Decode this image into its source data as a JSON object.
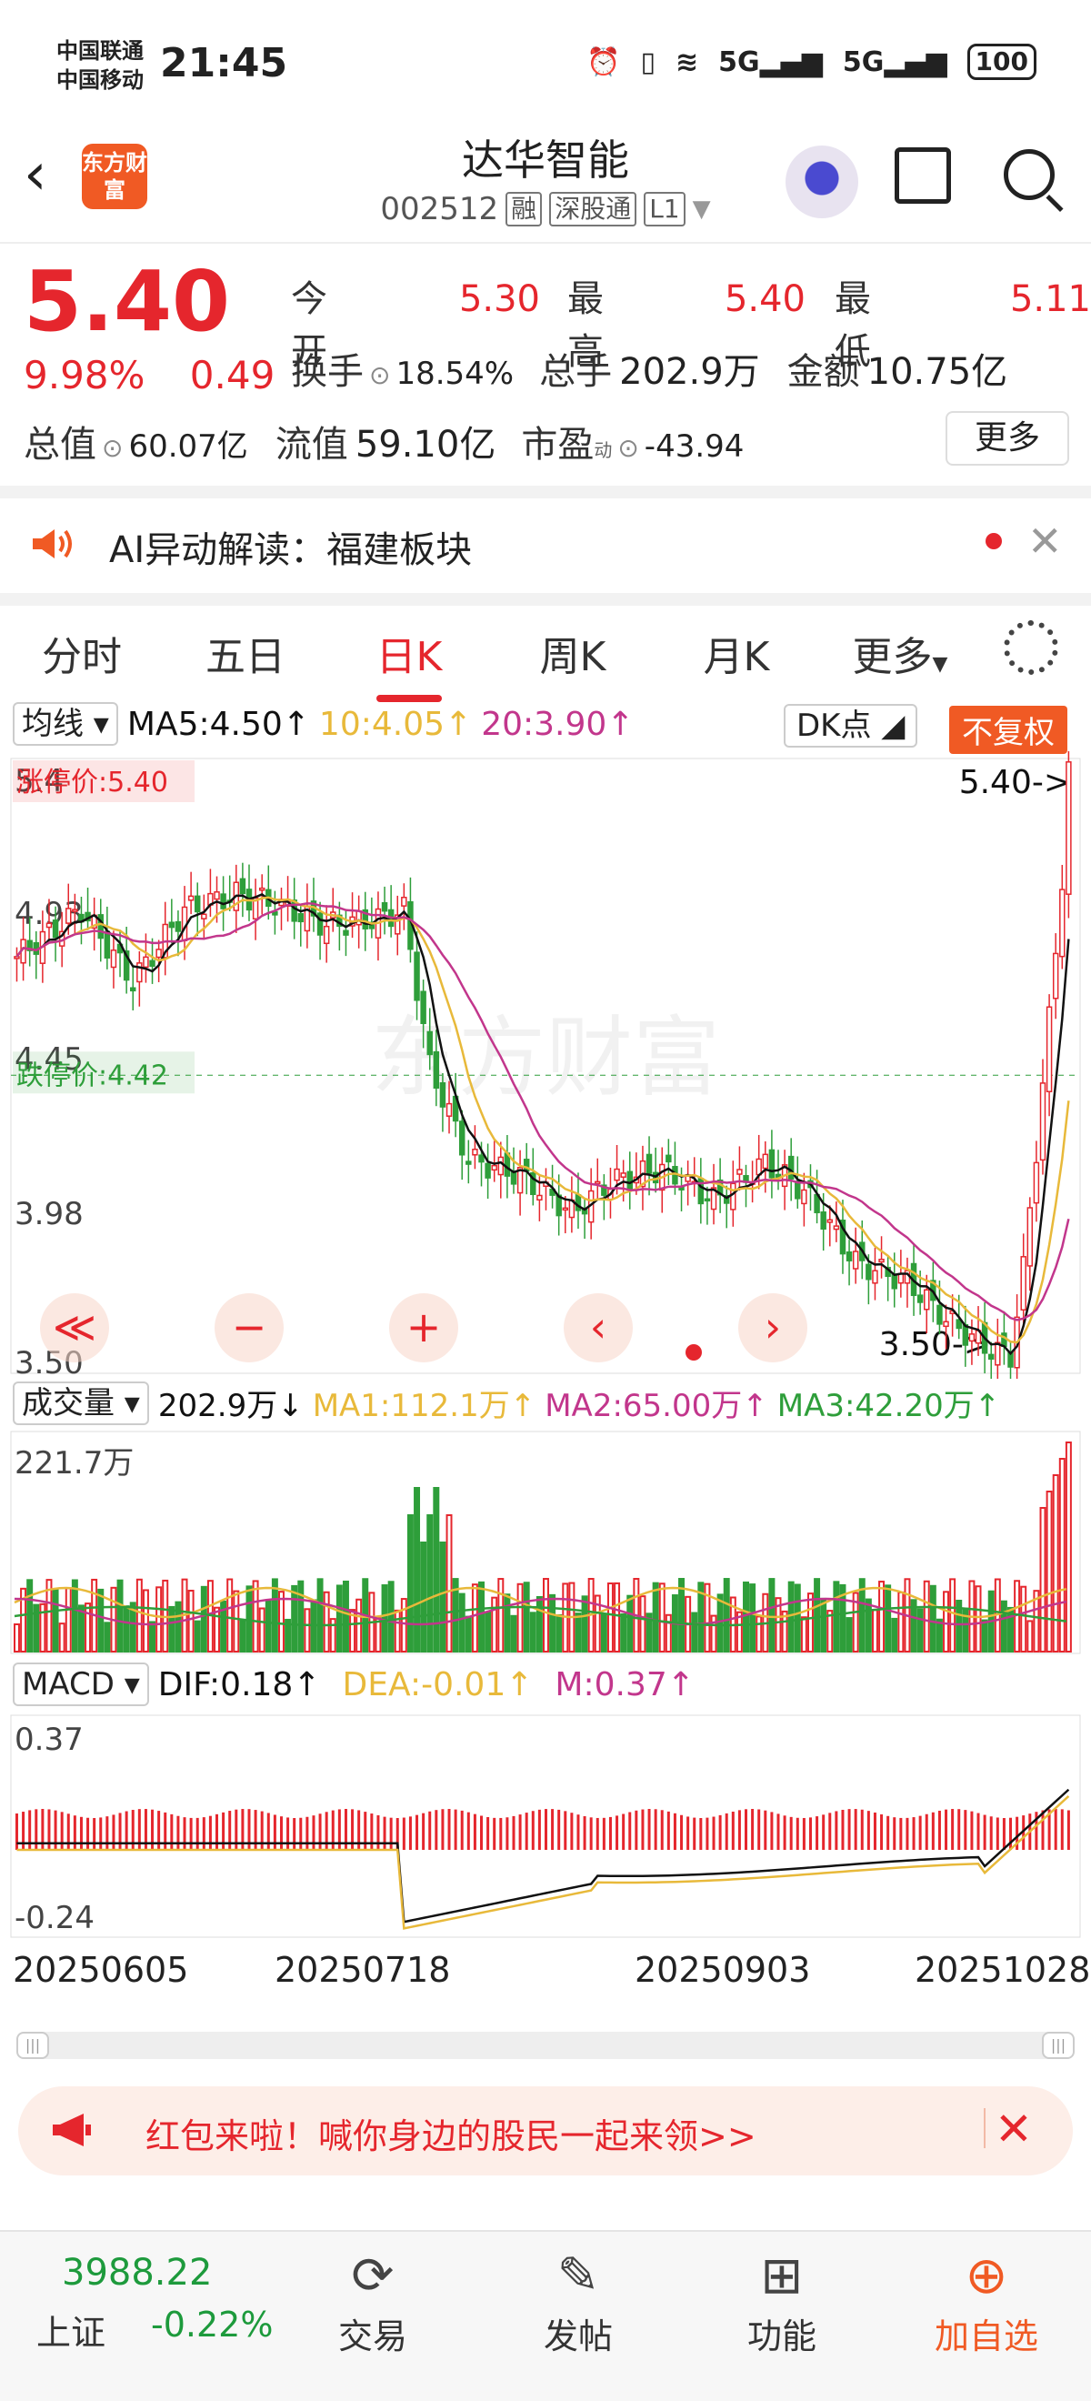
{
  "status_bar": {
    "carrier1": "中国联通",
    "carrier2": "中国移动",
    "time": "21:45",
    "net1": "5G",
    "net2": "5G",
    "battery": "100"
  },
  "header": {
    "logo_text": "东方财富",
    "stock_name": "达华智能",
    "stock_code": "002512",
    "tags": [
      "融",
      "深股通",
      "L1"
    ]
  },
  "quote": {
    "price": "5.40",
    "change_pct": "9.98%",
    "change": "0.49",
    "open_label": "今开",
    "open": "5.30",
    "high_label": "最高",
    "high": "5.40",
    "low_label": "最低",
    "low": "5.11",
    "turnover_label": "换手",
    "turnover": "18.54%",
    "volume_label": "总手",
    "volume": "202.9万",
    "amount_label": "金额",
    "amount": "10.75亿",
    "total_cap_label": "总值",
    "total_cap": "60.07亿",
    "float_cap_label": "流值",
    "float_cap": "59.10亿",
    "pe_label": "市盈",
    "pe_sup": "动",
    "pe": "-43.94",
    "more_label": "更多"
  },
  "ai_bar": {
    "text": "AI异动解读：福建板块"
  },
  "tabs": [
    "分时",
    "五日",
    "日K",
    "周K",
    "月K",
    "更多"
  ],
  "active_tab": "日K",
  "kline": {
    "indicator_label": "均线",
    "ma5": "MA5:4.50↑",
    "ma10": "10:4.05↑",
    "ma20": "20:3.90↑",
    "dk_label": "DK点",
    "adjust_label": "不复权",
    "limit_up_label": "涨停价:5.40",
    "limit_down_label": "跌停价:4.42",
    "high_mark": "5.40->",
    "low_mark": "3.50->",
    "axis_labels": [
      "5.4",
      "4.93",
      "4.45",
      "3.98",
      "3.50"
    ],
    "watermark": "东方财富",
    "colors": {
      "up": "#e5262d",
      "down": "#2e9e3a",
      "ma5": "#111111",
      "ma10": "#e8b93a",
      "ma20": "#c2368c"
    }
  },
  "volume": {
    "label": "成交量",
    "value": "202.9万↓",
    "ma1": "MA1:112.1万↑",
    "ma2": "MA2:65.00万↑",
    "ma3": "MA3:42.20万↑",
    "max_label": "221.7万"
  },
  "macd": {
    "label": "MACD",
    "dif": "DIF:0.18↑",
    "dea": "DEA:-0.01↑",
    "m": "M:0.37↑",
    "top_label": "0.37",
    "bottom_label": "-0.24"
  },
  "dates": [
    "20250605",
    "20250718",
    "20250903",
    "20251028"
  ],
  "chart_controls": [
    "≪",
    "−",
    "+",
    "‹",
    "›"
  ],
  "banner": {
    "text": "红包来啦！喊你身边的股民一起来领>>"
  },
  "bottom_nav": {
    "index_value": "3988.22",
    "index_name": "上证",
    "index_change": "-0.22%",
    "items": [
      "交易",
      "发帖",
      "功能",
      "加自选"
    ]
  }
}
